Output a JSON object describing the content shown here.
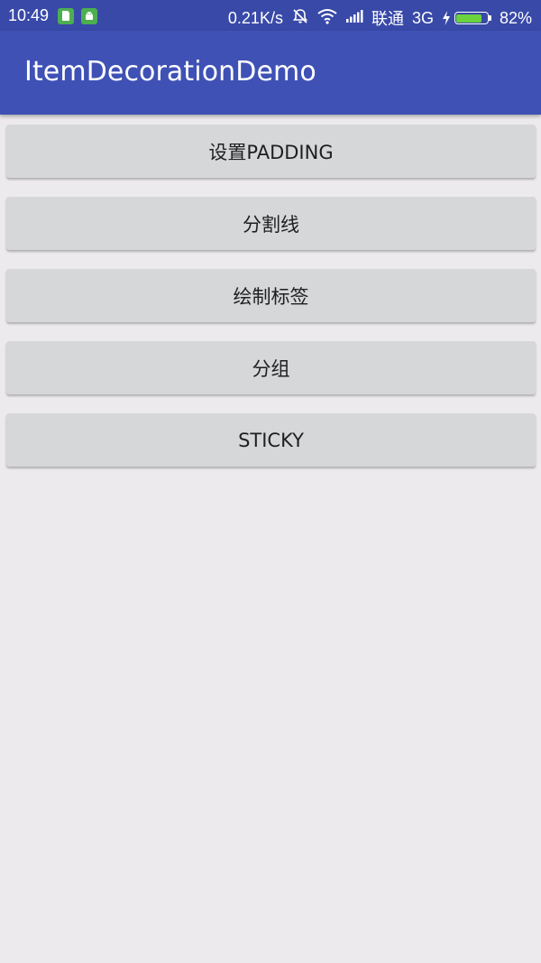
{
  "status_bar": {
    "time": "10:49",
    "net_speed": "0.21K/s",
    "carrier": "联通",
    "network_type": "3G",
    "battery_percent": "82%",
    "battery_level": 0.82,
    "icons": [
      "sim-card-icon",
      "android-debug-icon",
      "mute-icon",
      "wifi-icon",
      "signal-icon",
      "charging-icon",
      "battery-icon"
    ]
  },
  "app_bar": {
    "title": "ItemDecorationDemo",
    "color": "#3f51b5"
  },
  "buttons": [
    {
      "label": "设置PADDING"
    },
    {
      "label": "分割线"
    },
    {
      "label": "绘制标签"
    },
    {
      "label": "分组"
    },
    {
      "label": "STICKY"
    }
  ]
}
